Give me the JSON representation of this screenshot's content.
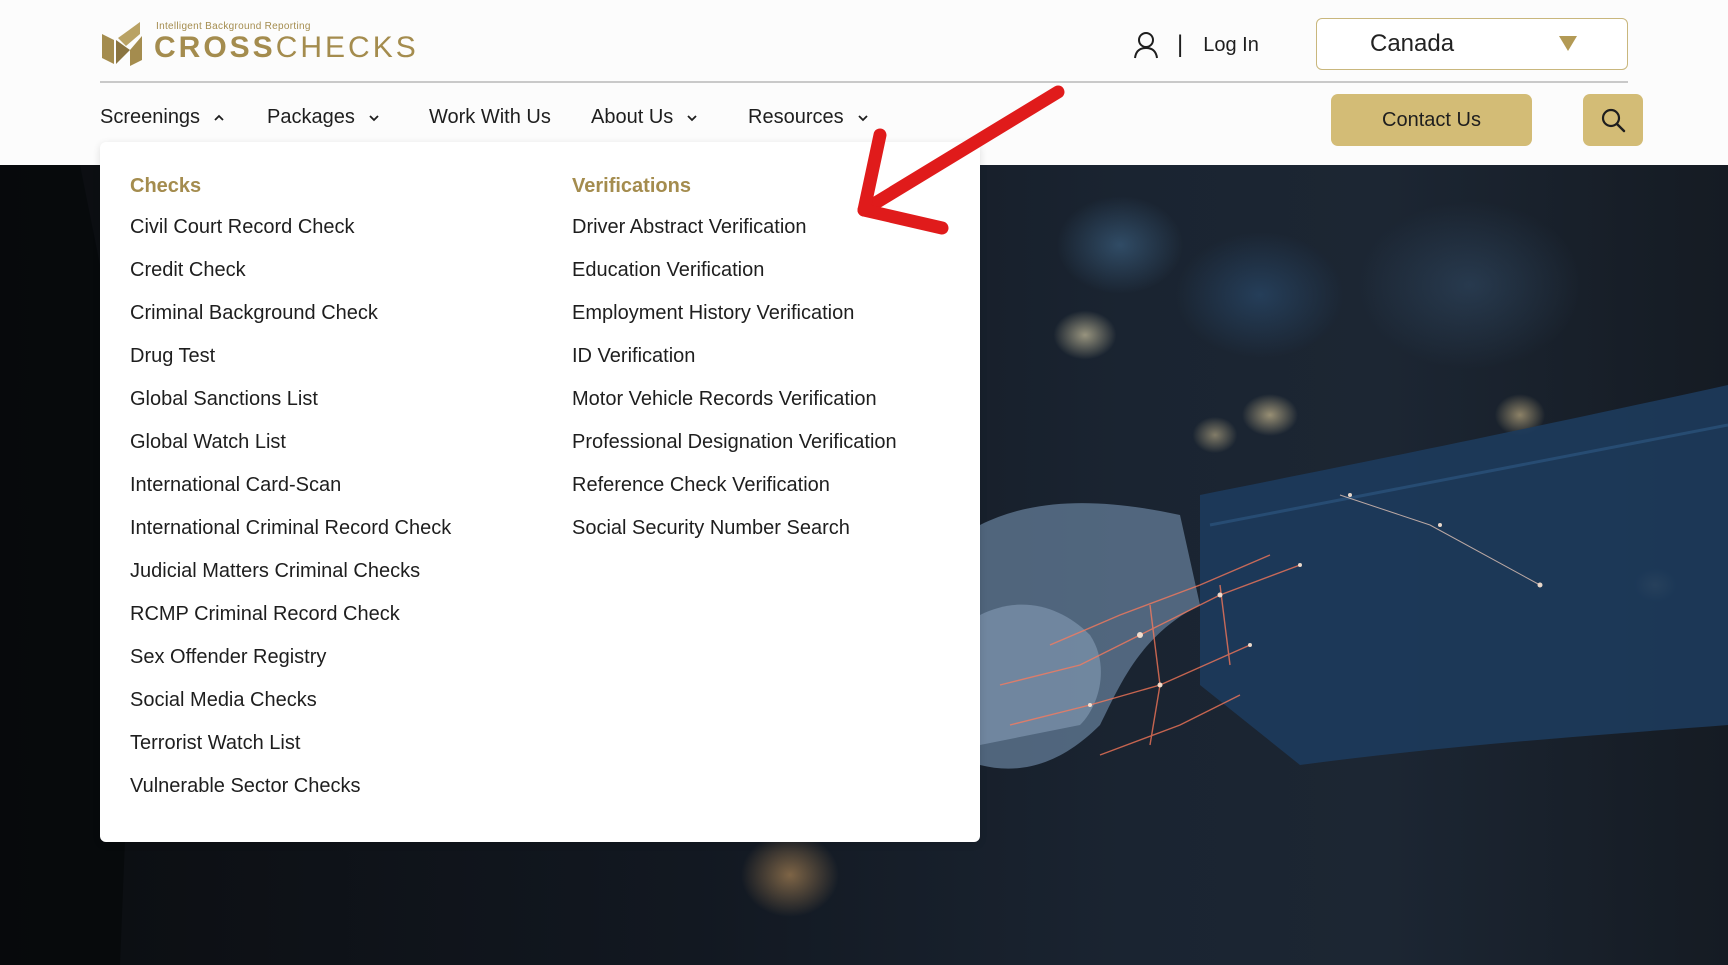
{
  "brand": {
    "tagline": "Intelligent Background Reporting",
    "name_bold": "CROSS",
    "name_light": "CHECKS",
    "color": "#a48c4e"
  },
  "header": {
    "login_separator": "|",
    "login_label": "Log In",
    "country": "Canada"
  },
  "nav": {
    "items": [
      {
        "label": "Screenings",
        "chevron": "chevron-up-icon"
      },
      {
        "label": "Packages",
        "chevron": "chevron-down-icon"
      },
      {
        "label": "Work With Us"
      },
      {
        "label": "About Us",
        "chevron": "chevron-down-icon"
      },
      {
        "label": "Resources",
        "chevron": "chevron-down-icon"
      }
    ],
    "contact_label": "Contact Us",
    "search_icon": "search-icon",
    "accent": "#d3bc76"
  },
  "dropdown": {
    "checks": {
      "heading": "Checks",
      "items": [
        "Civil Court Record Check",
        "Credit Check",
        "Criminal Background Check",
        "Drug Test",
        "Global Sanctions List",
        "Global Watch List",
        "International Card-Scan",
        "International Criminal Record Check",
        "Judicial Matters Criminal Checks",
        "RCMP Criminal Record Check",
        "Sex Offender Registry",
        "Social Media Checks",
        "Terrorist Watch List",
        "Vulnerable Sector Checks"
      ]
    },
    "verifications": {
      "heading": "Verifications",
      "items": [
        "Driver Abstract Verification",
        "Education Verification",
        "Employment History Verification",
        "ID Verification",
        "Motor Vehicle Records Verification",
        "Professional Designation Verification",
        "Reference Check Verification",
        "Social Security Number Search"
      ]
    }
  },
  "annotation": {
    "icon": "red-arrow-icon",
    "color": "#e01b1b"
  }
}
